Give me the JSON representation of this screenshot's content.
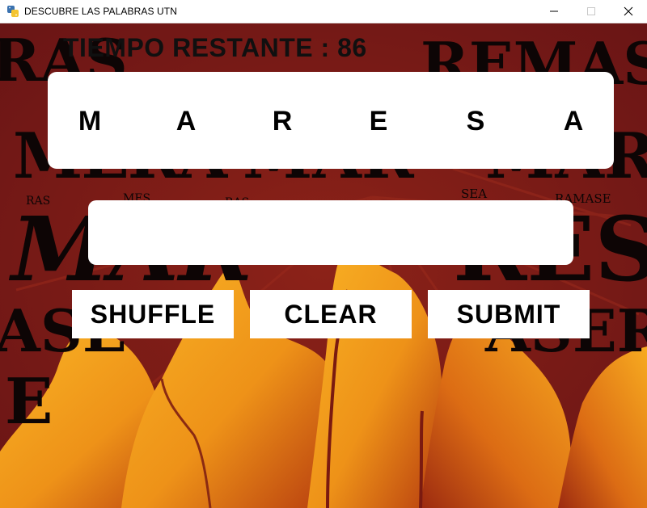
{
  "window": {
    "title": "DESCUBRE LAS PALABRAS UTN",
    "app_icon": "python-icon",
    "controls": [
      "minimize-icon",
      "maximize-icon",
      "close-icon"
    ]
  },
  "game": {
    "timer_text": "TIEMPO RESTANTE : 86",
    "letters": [
      "M",
      "A",
      "R",
      "E",
      "S",
      "A"
    ],
    "answer_text": "",
    "buttons": {
      "shuffle": "SHUFFLE",
      "clear": "CLEAR",
      "submit": "SUBMIT"
    }
  },
  "background": {
    "words": [
      "RAS",
      "REMAS",
      "MERA",
      "MAR",
      "MAR",
      "RAS",
      "MES",
      "RAS",
      "SEA",
      "RAMASE",
      "MAR",
      "RES",
      "ASE",
      "ASER",
      "ER",
      "E"
    ],
    "colors": {
      "base": "#7a1a1a",
      "flame_light": "#f7a81e",
      "flame_dark": "#c24a12"
    }
  }
}
